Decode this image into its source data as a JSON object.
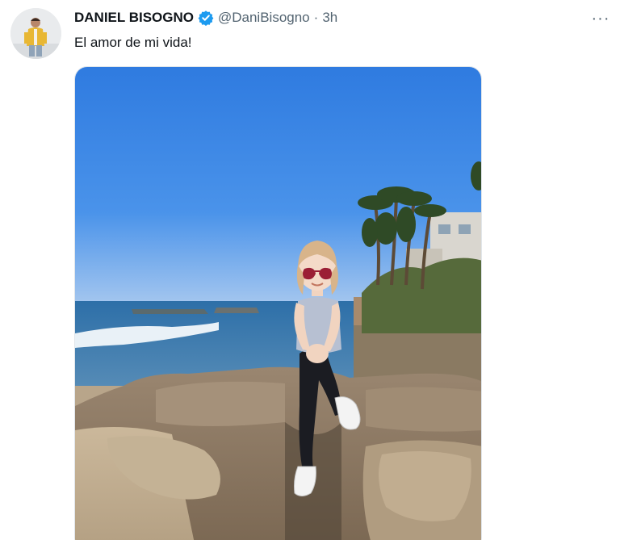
{
  "tweet": {
    "display_name": "DANIEL BISOGNO",
    "handle": "@DaniBisogno",
    "separator": "·",
    "time": "3h",
    "text": "El amor de mi vida!",
    "more_label": "···"
  },
  "icons": {
    "verified": "verified-badge-icon",
    "more": "more-options-icon"
  },
  "colors": {
    "verified": "#1d9bf0",
    "primary_text": "#0f1419",
    "secondary_text": "#536471"
  }
}
